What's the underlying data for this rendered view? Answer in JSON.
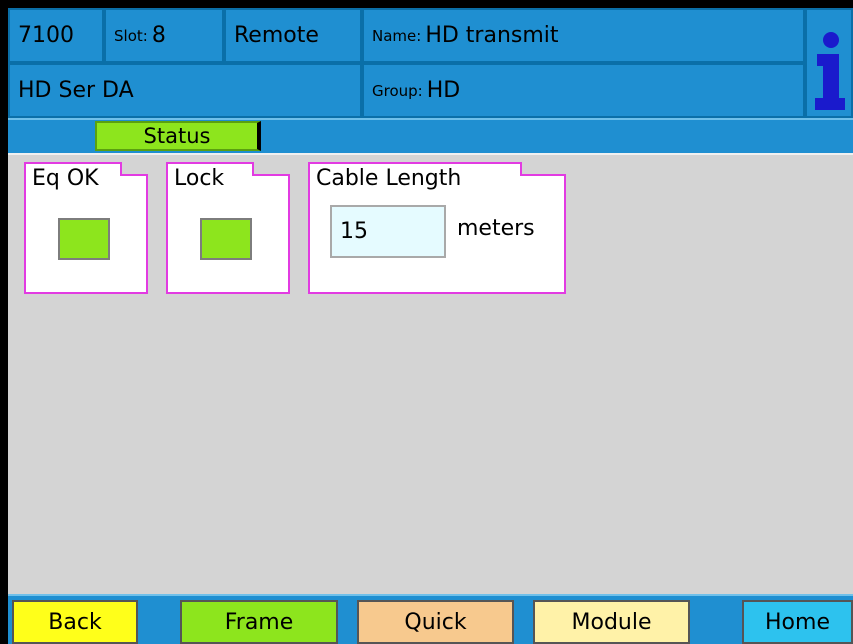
{
  "header": {
    "model": "7100",
    "slot_label": "Slot:",
    "slot_value": "8",
    "mode": "Remote",
    "name_label": "Name:",
    "name_value": "HD transmit",
    "module_type": "HD Ser DA",
    "group_label": "Group:",
    "group_value": "HD",
    "info_icon": "info-icon"
  },
  "tabs": [
    {
      "label": "Status",
      "active": true
    }
  ],
  "status": {
    "eq_ok": {
      "label": "Eq OK",
      "state": "ok",
      "color": "#8de51d"
    },
    "lock": {
      "label": "Lock",
      "state": "ok",
      "color": "#8de51d"
    },
    "cable_length": {
      "label": "Cable Length",
      "value": "15",
      "unit": "meters"
    }
  },
  "footer": {
    "back": {
      "label": "Back",
      "color": "#ffff1a"
    },
    "frame": {
      "label": "Frame",
      "color": "#8de51d"
    },
    "quick": {
      "label": "Quick",
      "color": "#f7c98e"
    },
    "module": {
      "label": "Module",
      "color": "#fff2a8"
    },
    "home": {
      "label": "Home",
      "color": "#2dc2ee"
    }
  },
  "colors": {
    "header_bg": "#1f8fd1",
    "content_bg": "#d4d4d4",
    "group_border": "#e23be2"
  }
}
